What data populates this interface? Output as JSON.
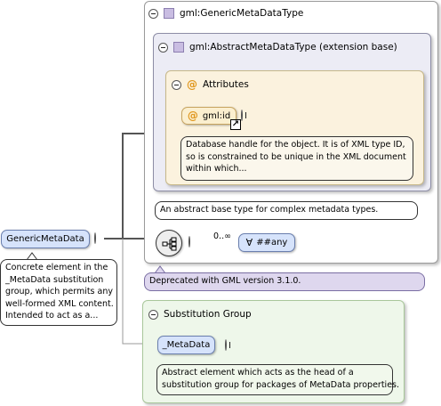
{
  "root_element": {
    "label": "GenericMetaData",
    "annotation": [
      "Concrete element in the",
      "_MetaData substitution",
      "group, which permits any",
      "well-formed XML content.",
      "Intended to act as a..."
    ]
  },
  "type_box": {
    "label": "gml:GenericMetaDataType",
    "deprecation_note": "Deprecated with GML version 3.1.0."
  },
  "extension_box": {
    "label": "gml:AbstractMetaDataType (extension base)",
    "annotation": "An abstract base type for complex metadata types."
  },
  "attributes_box": {
    "label": "Attributes",
    "attribute": {
      "name": "gml:id",
      "annotation": [
        "Database handle for the object. It is of XML type ID,",
        "so is constrained to be unique in the XML document",
        "within which..."
      ]
    }
  },
  "sequence": {
    "cardinality": "0..∞",
    "any_label": "##any"
  },
  "substitution_box": {
    "label": "Substitution Group",
    "element": "_MetaData",
    "annotation": [
      "Abstract element which acts as the head of a",
      "substitution group for packages of MetaData properties."
    ]
  },
  "colors": {
    "blue_node": "#d6e3fb",
    "attribute_fill": "#fbf2de",
    "extension_fill": "#ececf5",
    "substitution_fill": "#eef7ea",
    "deprecated_fill": "#ded7ee"
  }
}
